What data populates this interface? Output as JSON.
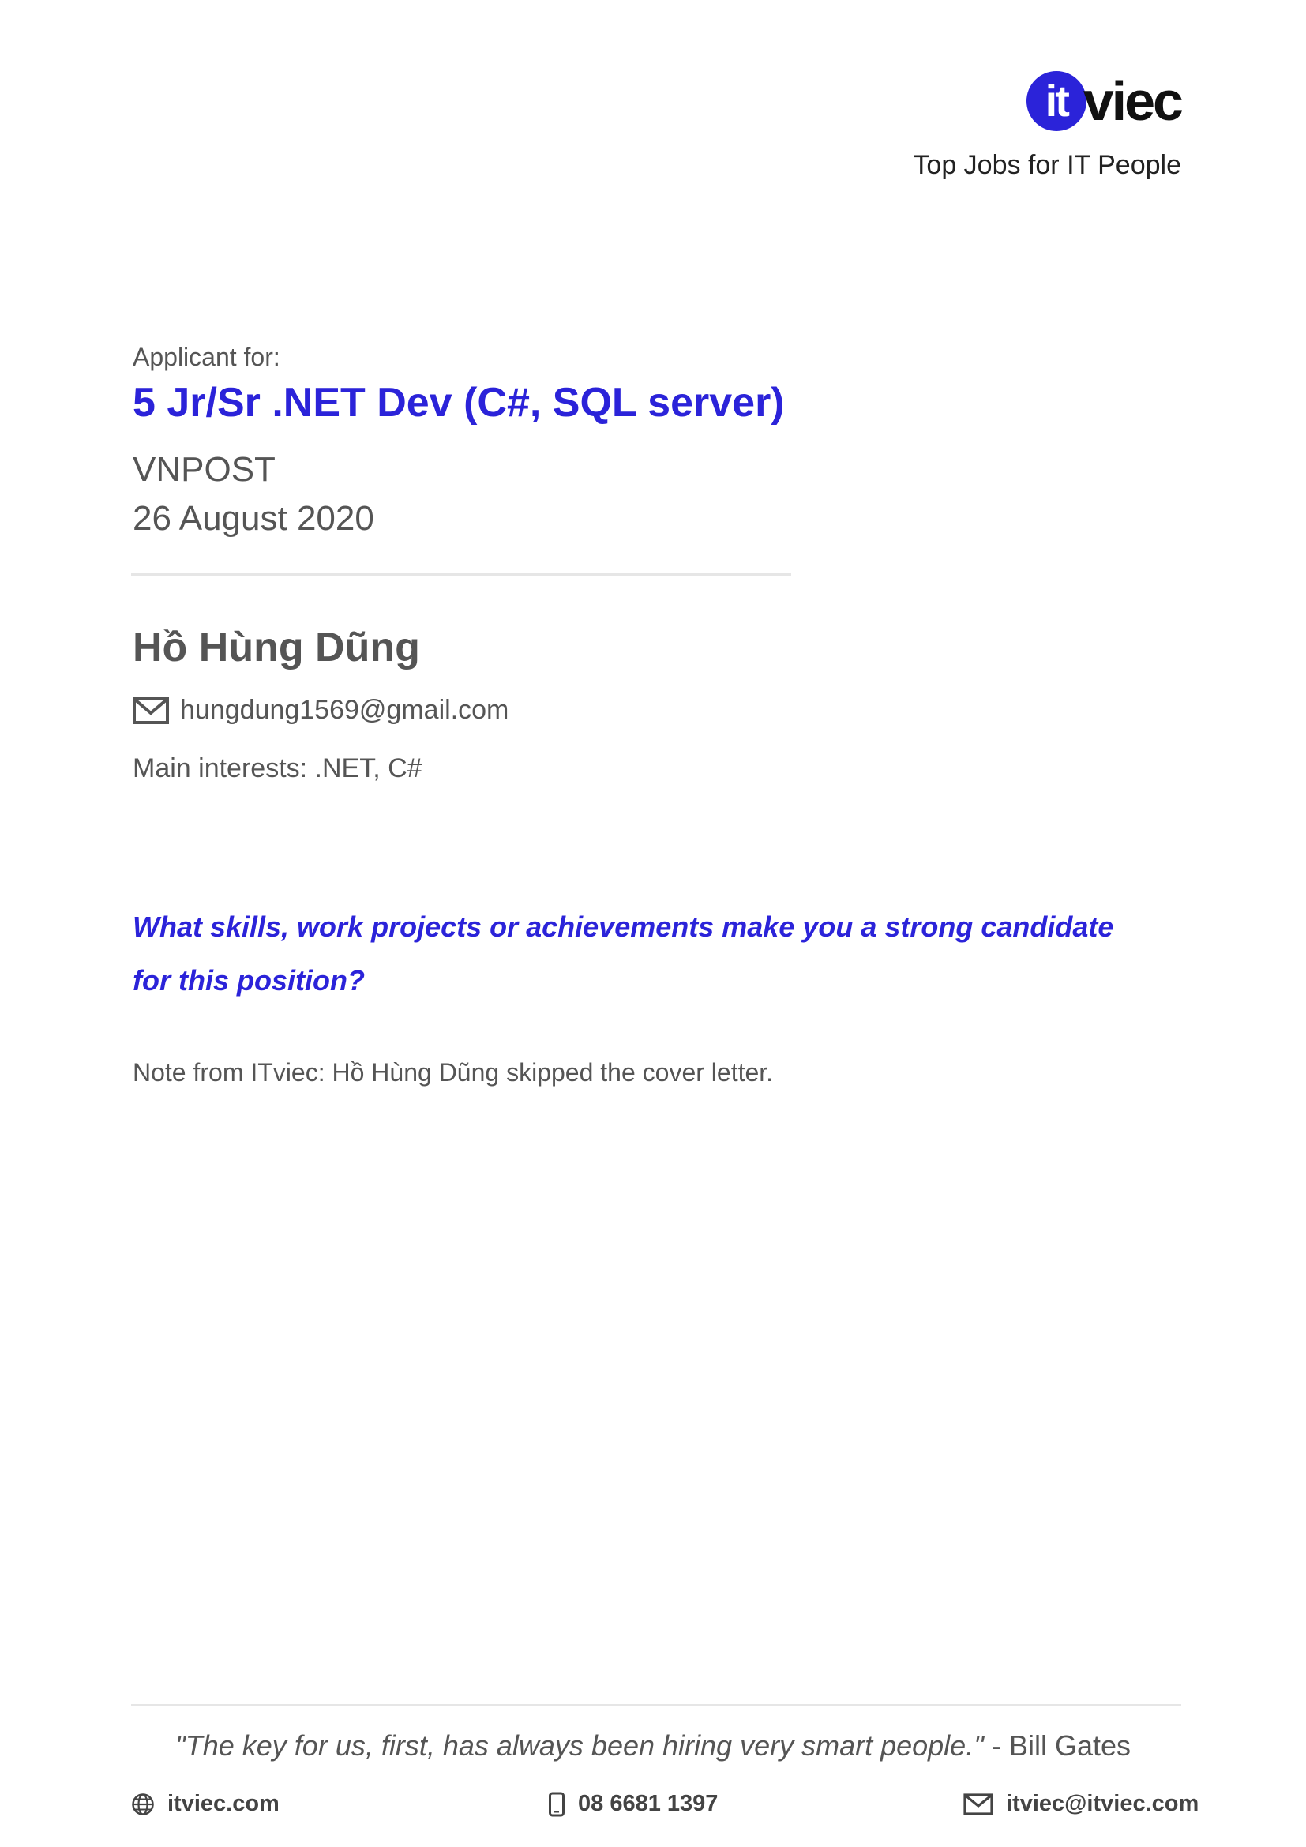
{
  "header": {
    "logo_mark": "it",
    "logo_word": "viec",
    "tagline": "Top Jobs for IT People"
  },
  "job": {
    "applicant_label": "Applicant for:",
    "title": "5 Jr/Sr .NET Dev (C#, SQL server)",
    "company": "VNPOST",
    "date": "26 August 2020"
  },
  "applicant": {
    "name": "Hồ Hùng Dũng",
    "email": "hungdung1569@gmail.com",
    "interests": "Main interests: .NET, C#",
    "email_icon": "envelope-icon"
  },
  "question": {
    "text": "What skills, work projects or achievements make you a strong candidate for this position?"
  },
  "note": {
    "text": "Note from ITviec: Hồ Hùng Dũng skipped the cover letter."
  },
  "footer": {
    "quote": "\"The key for us, first, has always been hiring very smart people.\"",
    "quote_author": " - Bill Gates",
    "website": "itviec.com",
    "phone": "08 6681 1397",
    "email": "itviec@itviec.com",
    "website_icon": "globe-icon",
    "phone_icon": "mobile-phone-icon",
    "email_icon": "envelope-icon"
  },
  "colors": {
    "brand_blue": "#2b23d9",
    "text_gray": "#555555",
    "divider": "#e6e6e6"
  }
}
